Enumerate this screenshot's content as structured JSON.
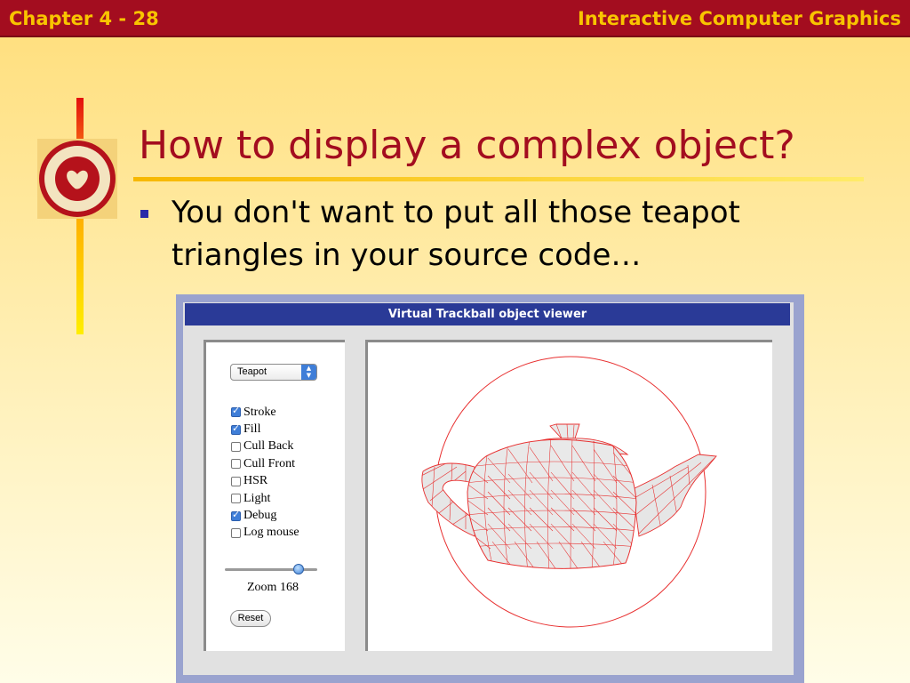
{
  "header": {
    "chapter": "Chapter 4 - 28",
    "course": "Interactive Computer Graphics"
  },
  "slide": {
    "title": "How to display a complex object?",
    "bullet": "You don't want to put all those teapot triangles in your source code…"
  },
  "viewer": {
    "window_title": "Virtual Trackball object viewer",
    "object_select": {
      "selected": "Teapot"
    },
    "options": [
      {
        "label": "Stroke",
        "checked": true
      },
      {
        "label": "Fill",
        "checked": true
      },
      {
        "label": "Cull Back",
        "checked": false
      },
      {
        "label": "Cull Front",
        "checked": false
      },
      {
        "label": "HSR",
        "checked": false
      },
      {
        "label": "Light",
        "checked": false
      },
      {
        "label": "Debug",
        "checked": true
      },
      {
        "label": "Log mouse",
        "checked": false
      }
    ],
    "zoom_label": "Zoom 168",
    "reset_label": "Reset"
  },
  "colors": {
    "header_bg": "#a30d1f",
    "header_text": "#f8c400",
    "title_text": "#a30d1f",
    "bullet": "#2a2aa8",
    "window_titlebar": "#2a3a97",
    "wireframe": "#e83030"
  }
}
